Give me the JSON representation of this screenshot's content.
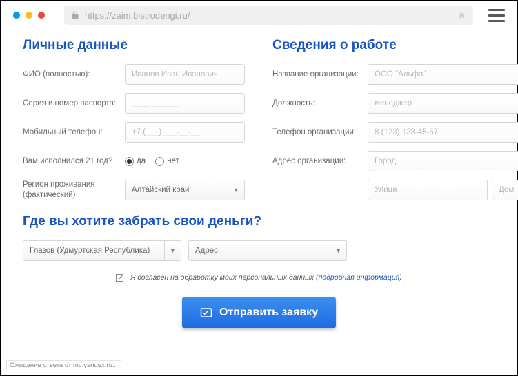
{
  "browser": {
    "url": "https://zaim.bistrodengi.ru/",
    "status": "Ожидание ответа от mc.yandex.ru..."
  },
  "personal": {
    "heading": "Личные данные",
    "fio_label": "ФИО (полностью):",
    "fio_ph": "Иванов Иван Иванович",
    "passport_label": "Серия и номер паспорта:",
    "passport_ph": "____ ______",
    "phone_label": "Мобильный телефон:",
    "phone_ph": "+7 (___) ___-__-__",
    "age_label": "Вам исполнился 21 год?",
    "age_yes": "да",
    "age_no": "нет",
    "region_label": "Регион проживания (фактический)",
    "region_value": "Алтайский край"
  },
  "work": {
    "heading": "Сведения о работе",
    "org_label": "Название организации:",
    "org_ph": "ООО \"Альфа\"",
    "pos_label": "Должность:",
    "pos_ph": "менеджер",
    "tel_label": "Телефон организации:",
    "tel_ph": "8 (123) 123-45-67",
    "addr_label": "Адрес организации:",
    "city_ph": "Город",
    "street_ph": "Улица",
    "house_ph": "Дом"
  },
  "pickup": {
    "heading": "Где вы хотите забрать свои деньги?",
    "city_value": "Глазов (Удмуртская Республика)",
    "addr_value": "Адрес"
  },
  "consent": {
    "text": "Я согласен на обработку моих персональных данных",
    "link": "(подробная информация)"
  },
  "submit_label": "Отправить заявку"
}
